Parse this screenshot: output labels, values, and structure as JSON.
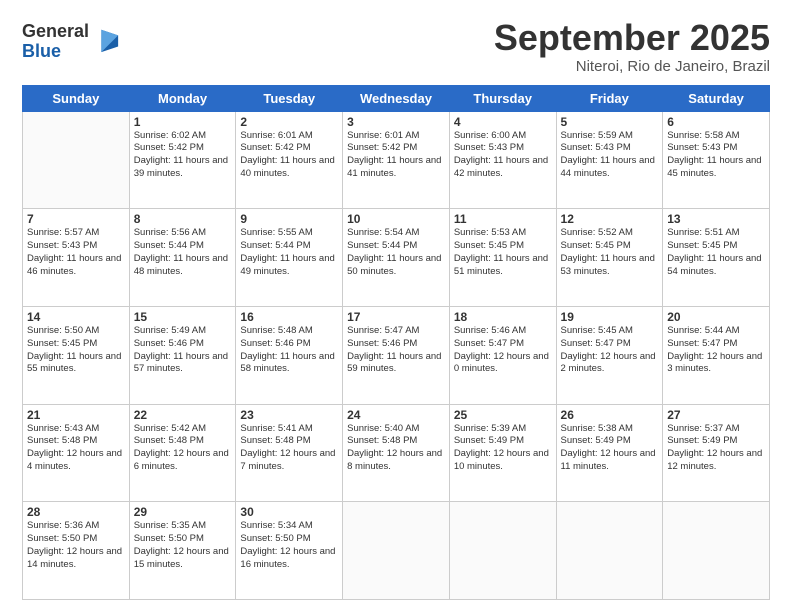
{
  "logo": {
    "line1": "General",
    "line2": "Blue"
  },
  "header": {
    "month": "September 2025",
    "location": "Niteroi, Rio de Janeiro, Brazil"
  },
  "weekdays": [
    "Sunday",
    "Monday",
    "Tuesday",
    "Wednesday",
    "Thursday",
    "Friday",
    "Saturday"
  ],
  "weeks": [
    [
      {
        "day": "",
        "sunrise": "",
        "sunset": "",
        "daylight": ""
      },
      {
        "day": "1",
        "sunrise": "Sunrise: 6:02 AM",
        "sunset": "Sunset: 5:42 PM",
        "daylight": "Daylight: 11 hours and 39 minutes."
      },
      {
        "day": "2",
        "sunrise": "Sunrise: 6:01 AM",
        "sunset": "Sunset: 5:42 PM",
        "daylight": "Daylight: 11 hours and 40 minutes."
      },
      {
        "day": "3",
        "sunrise": "Sunrise: 6:01 AM",
        "sunset": "Sunset: 5:42 PM",
        "daylight": "Daylight: 11 hours and 41 minutes."
      },
      {
        "day": "4",
        "sunrise": "Sunrise: 6:00 AM",
        "sunset": "Sunset: 5:43 PM",
        "daylight": "Daylight: 11 hours and 42 minutes."
      },
      {
        "day": "5",
        "sunrise": "Sunrise: 5:59 AM",
        "sunset": "Sunset: 5:43 PM",
        "daylight": "Daylight: 11 hours and 44 minutes."
      },
      {
        "day": "6",
        "sunrise": "Sunrise: 5:58 AM",
        "sunset": "Sunset: 5:43 PM",
        "daylight": "Daylight: 11 hours and 45 minutes."
      }
    ],
    [
      {
        "day": "7",
        "sunrise": "Sunrise: 5:57 AM",
        "sunset": "Sunset: 5:43 PM",
        "daylight": "Daylight: 11 hours and 46 minutes."
      },
      {
        "day": "8",
        "sunrise": "Sunrise: 5:56 AM",
        "sunset": "Sunset: 5:44 PM",
        "daylight": "Daylight: 11 hours and 48 minutes."
      },
      {
        "day": "9",
        "sunrise": "Sunrise: 5:55 AM",
        "sunset": "Sunset: 5:44 PM",
        "daylight": "Daylight: 11 hours and 49 minutes."
      },
      {
        "day": "10",
        "sunrise": "Sunrise: 5:54 AM",
        "sunset": "Sunset: 5:44 PM",
        "daylight": "Daylight: 11 hours and 50 minutes."
      },
      {
        "day": "11",
        "sunrise": "Sunrise: 5:53 AM",
        "sunset": "Sunset: 5:45 PM",
        "daylight": "Daylight: 11 hours and 51 minutes."
      },
      {
        "day": "12",
        "sunrise": "Sunrise: 5:52 AM",
        "sunset": "Sunset: 5:45 PM",
        "daylight": "Daylight: 11 hours and 53 minutes."
      },
      {
        "day": "13",
        "sunrise": "Sunrise: 5:51 AM",
        "sunset": "Sunset: 5:45 PM",
        "daylight": "Daylight: 11 hours and 54 minutes."
      }
    ],
    [
      {
        "day": "14",
        "sunrise": "Sunrise: 5:50 AM",
        "sunset": "Sunset: 5:45 PM",
        "daylight": "Daylight: 11 hours and 55 minutes."
      },
      {
        "day": "15",
        "sunrise": "Sunrise: 5:49 AM",
        "sunset": "Sunset: 5:46 PM",
        "daylight": "Daylight: 11 hours and 57 minutes."
      },
      {
        "day": "16",
        "sunrise": "Sunrise: 5:48 AM",
        "sunset": "Sunset: 5:46 PM",
        "daylight": "Daylight: 11 hours and 58 minutes."
      },
      {
        "day": "17",
        "sunrise": "Sunrise: 5:47 AM",
        "sunset": "Sunset: 5:46 PM",
        "daylight": "Daylight: 11 hours and 59 minutes."
      },
      {
        "day": "18",
        "sunrise": "Sunrise: 5:46 AM",
        "sunset": "Sunset: 5:47 PM",
        "daylight": "Daylight: 12 hours and 0 minutes."
      },
      {
        "day": "19",
        "sunrise": "Sunrise: 5:45 AM",
        "sunset": "Sunset: 5:47 PM",
        "daylight": "Daylight: 12 hours and 2 minutes."
      },
      {
        "day": "20",
        "sunrise": "Sunrise: 5:44 AM",
        "sunset": "Sunset: 5:47 PM",
        "daylight": "Daylight: 12 hours and 3 minutes."
      }
    ],
    [
      {
        "day": "21",
        "sunrise": "Sunrise: 5:43 AM",
        "sunset": "Sunset: 5:48 PM",
        "daylight": "Daylight: 12 hours and 4 minutes."
      },
      {
        "day": "22",
        "sunrise": "Sunrise: 5:42 AM",
        "sunset": "Sunset: 5:48 PM",
        "daylight": "Daylight: 12 hours and 6 minutes."
      },
      {
        "day": "23",
        "sunrise": "Sunrise: 5:41 AM",
        "sunset": "Sunset: 5:48 PM",
        "daylight": "Daylight: 12 hours and 7 minutes."
      },
      {
        "day": "24",
        "sunrise": "Sunrise: 5:40 AM",
        "sunset": "Sunset: 5:48 PM",
        "daylight": "Daylight: 12 hours and 8 minutes."
      },
      {
        "day": "25",
        "sunrise": "Sunrise: 5:39 AM",
        "sunset": "Sunset: 5:49 PM",
        "daylight": "Daylight: 12 hours and 10 minutes."
      },
      {
        "day": "26",
        "sunrise": "Sunrise: 5:38 AM",
        "sunset": "Sunset: 5:49 PM",
        "daylight": "Daylight: 12 hours and 11 minutes."
      },
      {
        "day": "27",
        "sunrise": "Sunrise: 5:37 AM",
        "sunset": "Sunset: 5:49 PM",
        "daylight": "Daylight: 12 hours and 12 minutes."
      }
    ],
    [
      {
        "day": "28",
        "sunrise": "Sunrise: 5:36 AM",
        "sunset": "Sunset: 5:50 PM",
        "daylight": "Daylight: 12 hours and 14 minutes."
      },
      {
        "day": "29",
        "sunrise": "Sunrise: 5:35 AM",
        "sunset": "Sunset: 5:50 PM",
        "daylight": "Daylight: 12 hours and 15 minutes."
      },
      {
        "day": "30",
        "sunrise": "Sunrise: 5:34 AM",
        "sunset": "Sunset: 5:50 PM",
        "daylight": "Daylight: 12 hours and 16 minutes."
      },
      {
        "day": "",
        "sunrise": "",
        "sunset": "",
        "daylight": ""
      },
      {
        "day": "",
        "sunrise": "",
        "sunset": "",
        "daylight": ""
      },
      {
        "day": "",
        "sunrise": "",
        "sunset": "",
        "daylight": ""
      },
      {
        "day": "",
        "sunrise": "",
        "sunset": "",
        "daylight": ""
      }
    ]
  ]
}
